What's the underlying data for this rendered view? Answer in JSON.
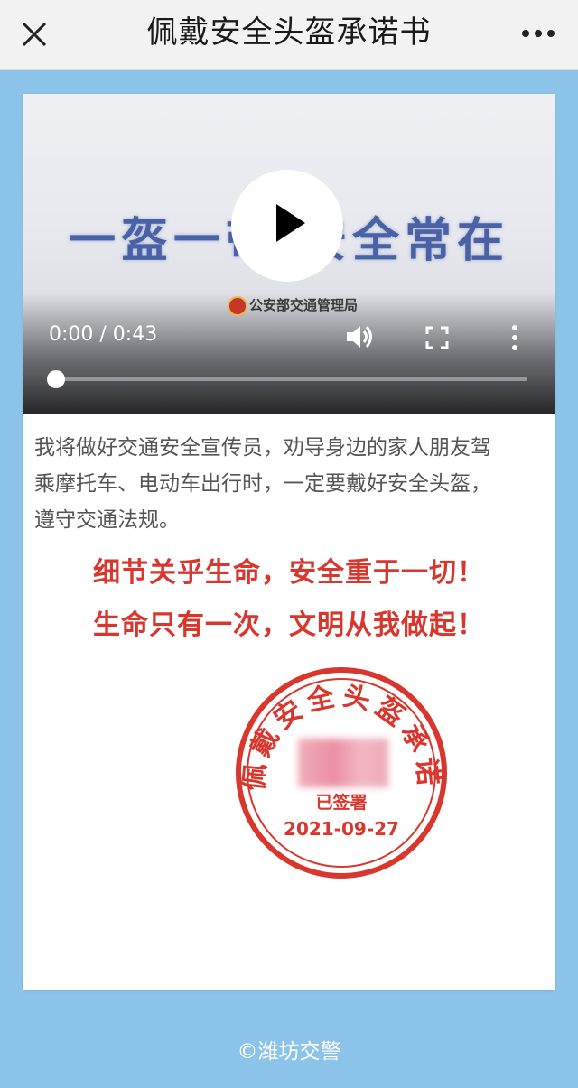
{
  "header": {
    "title": "佩戴安全头盔承诺书",
    "close_icon": "close-icon",
    "more_icon": "more-horizontal-icon"
  },
  "video": {
    "slogan": "一盔一带 安全常在",
    "org": "公安部交通管理局",
    "time": "0:00 / 0:43",
    "progress": 0,
    "play_icon": "play-icon",
    "volume_icon": "volume-icon",
    "fullscreen_icon": "fullscreen-icon",
    "more_icon": "more-vertical-icon"
  },
  "content": {
    "paragraph_lines": [
      "我将做好交通安全宣传员，劝导身边的家人朋友驾",
      "乘摩托车、电动车出行时，一定要戴好安全头盔，",
      "遵守交通法规。"
    ],
    "slogan_1": "细节关乎生命，安全重于一切！",
    "slogan_2": "生命只有一次，文明从我做起！"
  },
  "seal": {
    "ring_text": "佩戴安全头盔承诺",
    "signed": "已签署",
    "date": "2021-09-27",
    "color": "#d9362d"
  },
  "footer": {
    "text": "©潍坊交警"
  },
  "colors": {
    "background": "#8cc3e8",
    "accent_red": "#d9362d",
    "slogan_blue": "#2f4a9a"
  }
}
